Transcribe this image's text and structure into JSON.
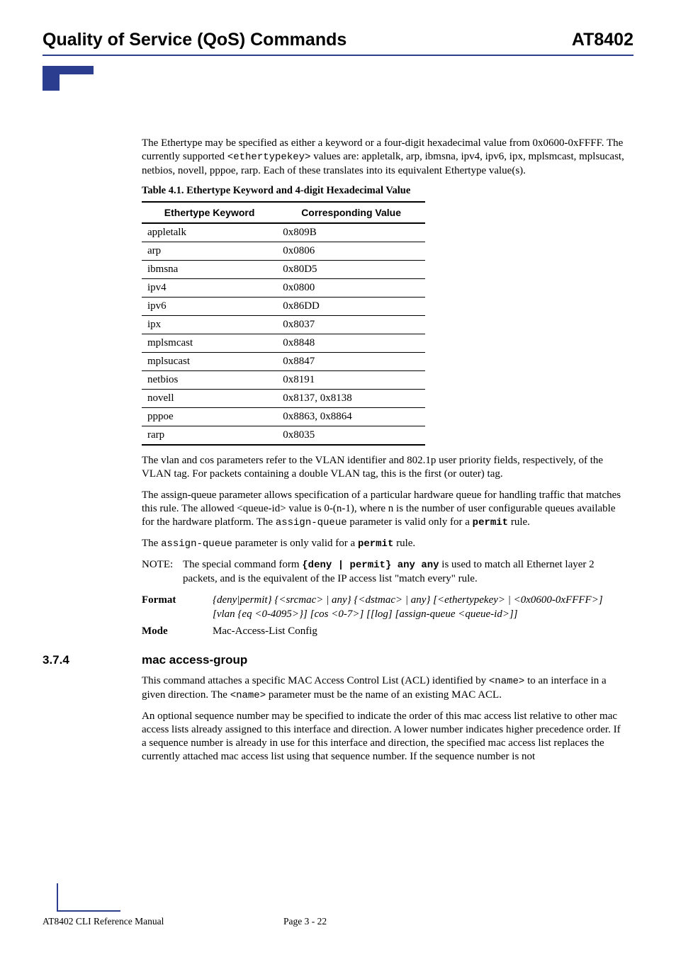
{
  "header": {
    "left": "Quality of Service (QoS) Commands",
    "right": "AT8402"
  },
  "intro": {
    "p1_a": "The Ethertype may be specified as either a keyword or a four-digit hexadecimal value from 0x0600-0xFFFF. The currently supported ",
    "p1_code": "<ethertypekey>",
    "p1_b": " values are: appletalk, arp, ibmsna, ipv4, ipv6, ipx, mplsmcast, mplsucast, netbios, novell, pppoe, rarp. Each of these translates into its equivalent Ethertype value(s)."
  },
  "table": {
    "caption": "Table 4.1. Ethertype Keyword and 4-digit Hexadecimal Value",
    "col1": "Ethertype Keyword",
    "col2": "Corresponding Value",
    "rows": [
      {
        "k": "appletalk",
        "v": "0x809B"
      },
      {
        "k": "arp",
        "v": "0x0806"
      },
      {
        "k": "ibmsna",
        "v": "0x80D5"
      },
      {
        "k": "ipv4",
        "v": "0x0800"
      },
      {
        "k": "ipv6",
        "v": "0x86DD"
      },
      {
        "k": "ipx",
        "v": "0x8037"
      },
      {
        "k": "mplsmcast",
        "v": "0x8848"
      },
      {
        "k": "mplsucast",
        "v": "0x8847"
      },
      {
        "k": "netbios",
        "v": "0x8191"
      },
      {
        "k": "novell",
        "v": "0x8137, 0x8138"
      },
      {
        "k": "pppoe",
        "v": "0x8863, 0x8864"
      },
      {
        "k": "rarp",
        "v": "0x8035"
      }
    ]
  },
  "after_table": {
    "p1": "The vlan and cos parameters refer to the VLAN identifier and 802.1p user priority fields, respectively, of the VLAN tag. For packets containing a double VLAN tag, this is the first (or outer) tag.",
    "p2_a": "The assign-queue parameter allows specification of a particular hardware queue for handling traffic that matches this rule. The allowed <queue-id> value is 0-(n-1), where n is the number of user configurable queues available for the hardware platform. The ",
    "p2_code": "assign-queue",
    "p2_b": " parameter is valid only for a ",
    "p2_permit": "permit",
    "p2_c": " rule.",
    "p3_a": "The ",
    "p3_code": "assign-queue",
    "p3_b": " parameter is only valid for a ",
    "p3_permit": "permit",
    "p3_c": " rule."
  },
  "note": {
    "label": "NOTE:",
    "body_a": "The special command form ",
    "body_code": "{deny | permit}",
    "body_any": " any any",
    "body_b": " is used to match all Ethernet layer 2 packets, and is the equivalent of the IP access list \"match every\" rule."
  },
  "defs": {
    "format_label": "Format",
    "format_body": "{deny|permit} {<srcmac> | any} {<dstmac> | any} [<ethertypekey> | <0x0600-0xFFFF>] [vlan {eq <0-4095>}] [cos <0-7>] [[log] [assign-queue <queue-id>]]",
    "mode_label": "Mode",
    "mode_body": "Mac-Access-List Config"
  },
  "section": {
    "num": "3.7.4",
    "title": "mac access-group",
    "p1_a": "This command attaches a specific MAC Access Control List (ACL) identified by ",
    "p1_code1": "<name>",
    "p1_b": " to an interface in a given direction. The ",
    "p1_code2": "<name>",
    "p1_c": " parameter must be the name of an existing MAC ACL.",
    "p2": "An optional sequence number may be specified to indicate the order of this mac access list relative to other mac access lists already assigned to this interface and direction. A lower number indicates higher precedence order. If a sequence number is already in use for this interface and direction, the specified mac access list replaces the currently attached mac access list using that sequence number. If the sequence number is not"
  },
  "footer": {
    "left": "AT8402 CLI Reference Manual",
    "center": "Page 3 - 22"
  }
}
